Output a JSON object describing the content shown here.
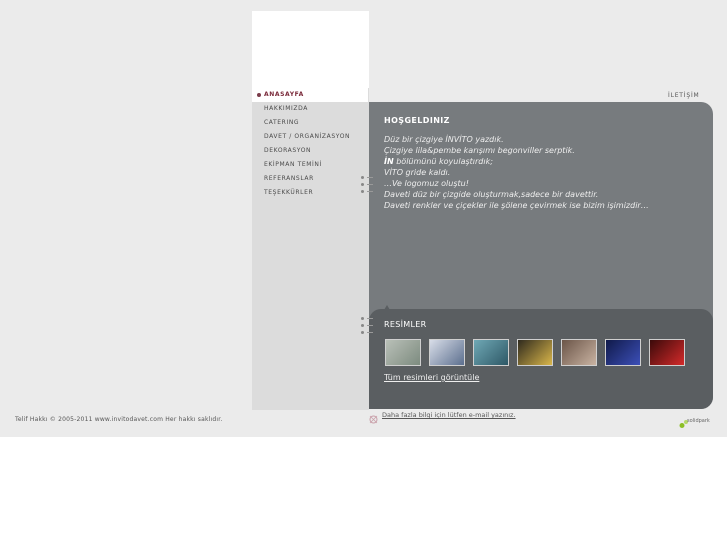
{
  "nav": {
    "items": [
      {
        "label": "ANASAYFA"
      },
      {
        "label": "HAKKIMIZDA"
      },
      {
        "label": "CATERING"
      },
      {
        "label": "DAVET / ORGANİZASYON"
      },
      {
        "label": "DEKORASYON"
      },
      {
        "label": "EKİPMAN TEMİNİ"
      },
      {
        "label": "REFERANSLAR"
      },
      {
        "label": "TEŞEKKÜRLER"
      }
    ]
  },
  "header": {
    "contact_link": "İLETİŞİM"
  },
  "welcome": {
    "title": "HOŞGELDINIZ",
    "line1": "Düz bir çizgiye İNVİTO yazdık.",
    "line2": "Çizgiye lila&pembe karışımı begonviller serptik.",
    "line3_bold": "İN",
    "line3_rest": " bölümünü koyulaştırdık;",
    "line4": "VİTO gride kaldı.",
    "line5": "…Ve logomuz oluştu!",
    "line6": "Daveti düz bir çizgide oluşturmak,sadece bir davettir.",
    "line7": "Daveti renkler ve çiçekler ile şölene çevirmek ise bizim işimizdir…"
  },
  "gallery": {
    "title": "RESİMLER",
    "view_all": "Tüm resimleri görüntüle",
    "thumbnails": [
      {
        "colors": [
          "#b9c0b8",
          "#7d8b7f"
        ]
      },
      {
        "colors": [
          "#d8dde8",
          "#5c6f8e"
        ]
      },
      {
        "colors": [
          "#6fa8b5",
          "#2e5866"
        ]
      },
      {
        "colors": [
          "#2f2a1e",
          "#d9b64a"
        ]
      },
      {
        "colors": [
          "#6b5548",
          "#c9b3a2"
        ]
      },
      {
        "colors": [
          "#101a4a",
          "#3c4fb8"
        ]
      },
      {
        "colors": [
          "#3a0a0a",
          "#d42a2a"
        ]
      }
    ]
  },
  "footer": {
    "copyright": "Telif Hakkı © 2005-2011 www.invitodavet.com Her hakkı saklıdır.",
    "mail_link": "Daha fazla bilgi için lütfen e-mail yazınız.",
    "brand": "solidpark"
  },
  "colors": {
    "accent": "#7a2a3a",
    "panel": "#777b7e",
    "panel_dark": "#5a5e61",
    "nav_bg": "#dcdcdc"
  }
}
